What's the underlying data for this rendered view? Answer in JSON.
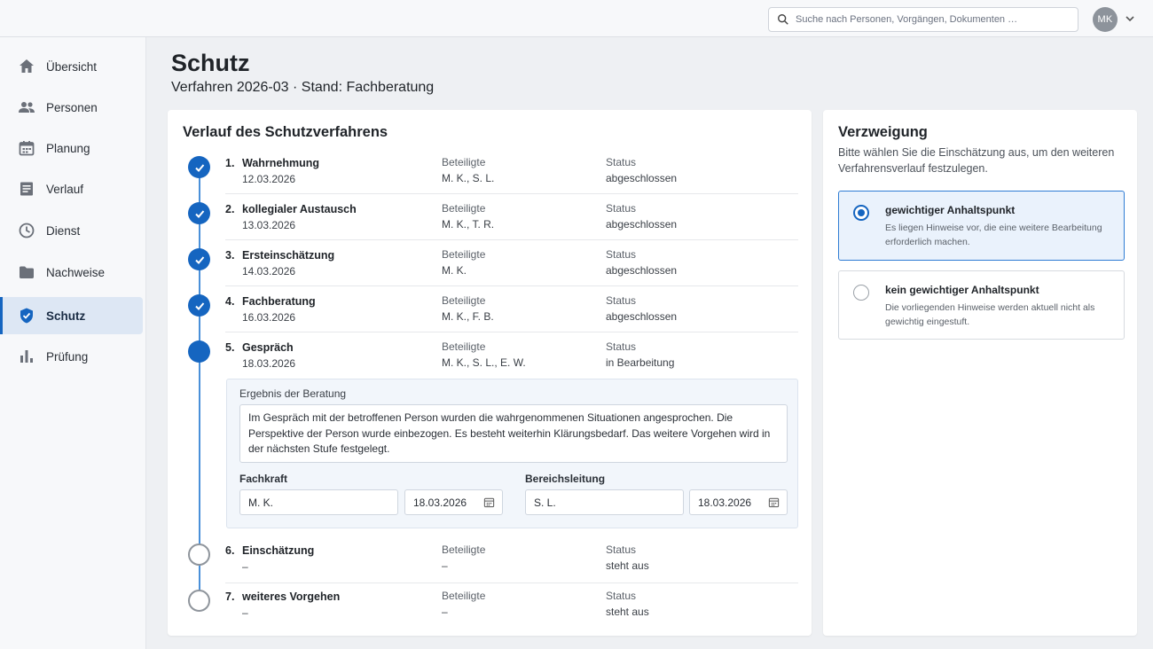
{
  "topbar": {
    "search_placeholder": "Suche nach Personen, Vorgängen, Dokumenten …",
    "avatar_initials": "MK"
  },
  "sidebar": {
    "items": [
      {
        "label": "Übersicht",
        "icon": "home-icon"
      },
      {
        "label": "Personen",
        "icon": "people-icon"
      },
      {
        "label": "Planung",
        "icon": "calendar-icon"
      },
      {
        "label": "Verlauf",
        "icon": "document-icon"
      },
      {
        "label": "Dienst",
        "icon": "clock-icon"
      },
      {
        "label": "Nachweise",
        "icon": "folder-icon"
      },
      {
        "label": "Schutz",
        "icon": "shield-icon",
        "active": true
      },
      {
        "label": "Prüfung",
        "icon": "bar-chart-icon"
      }
    ]
  },
  "header": {
    "title": "Schutz",
    "subtitle": "Verfahren 2026-03  ·  Stand: Fachberatung"
  },
  "main": {
    "title": "Verlauf des Schutzverfahrens",
    "participants_label": "Beteiligte",
    "status_label": "Status",
    "steps": [
      {
        "num": "1.",
        "name": "Wahrnehmung",
        "date": "12.03.2026",
        "participants": "M. K., S. L.",
        "status": "abgeschlossen",
        "state": "done"
      },
      {
        "num": "2.",
        "name": "kollegialer Austausch",
        "date": "13.03.2026",
        "participants": "M. K., T. R.",
        "status": "abgeschlossen",
        "state": "done"
      },
      {
        "num": "3.",
        "name": "Ersteinschätzung",
        "date": "14.03.2026",
        "participants": "M. K.",
        "status": "abgeschlossen",
        "state": "done"
      },
      {
        "num": "4.",
        "name": "Fachberatung",
        "date": "16.03.2026",
        "participants": "M. K., F. B.",
        "status": "abgeschlossen",
        "state": "done"
      },
      {
        "num": "5.",
        "name": "Gespräch",
        "date": "18.03.2026",
        "participants": "M. K., S. L., E. W.",
        "status": "in Bearbeitung",
        "state": "current"
      },
      {
        "num": "6.",
        "name": "Einschätzung",
        "date": "–",
        "participants": "–",
        "status": "steht aus",
        "state": "open"
      },
      {
        "num": "7.",
        "name": "weiteres Vorgehen",
        "date": "–",
        "participants": "–",
        "status": "steht aus",
        "state": "open"
      }
    ],
    "detail": {
      "result_label": "Ergebnis der Beratung",
      "result_text": "Im Gespräch mit der betroffenen Person wurden die wahrgenommenen Situationen angesprochen. Die Perspektive der Person wurde einbezogen. Es besteht weiterhin Klärungsbedarf. Das weitere Vorgehen wird in der nächsten Stufe festgelegt.",
      "fachkraft_label": "Fachkraft",
      "fachkraft_value": "M. K.",
      "fachkraft_date": "18.03.2026",
      "leitung_label": "Bereichsleitung",
      "leitung_value": "S. L.",
      "leitung_date": "18.03.2026"
    }
  },
  "side": {
    "title": "Verzweigung",
    "description": "Bitte wählen Sie die Einschätzung aus, um den weiteren Verfahrensverlauf festzulegen.",
    "options": [
      {
        "title": "gewichtiger Anhaltspunkt",
        "description": "Es liegen Hinweise vor, die eine weitere Bearbeitung erforderlich machen.",
        "selected": true
      },
      {
        "title": "kein gewichtiger Anhaltspunkt",
        "description": "Die vorliegenden Hinweise werden aktuell nicht als gewichtig eingestuft.",
        "selected": false
      }
    ]
  },
  "colors": {
    "accent": "#1565c0",
    "timeline_line": "#4a90d9",
    "selected_bg": "#eaf2fc",
    "sidebar_active_bg": "#dde7f4"
  }
}
